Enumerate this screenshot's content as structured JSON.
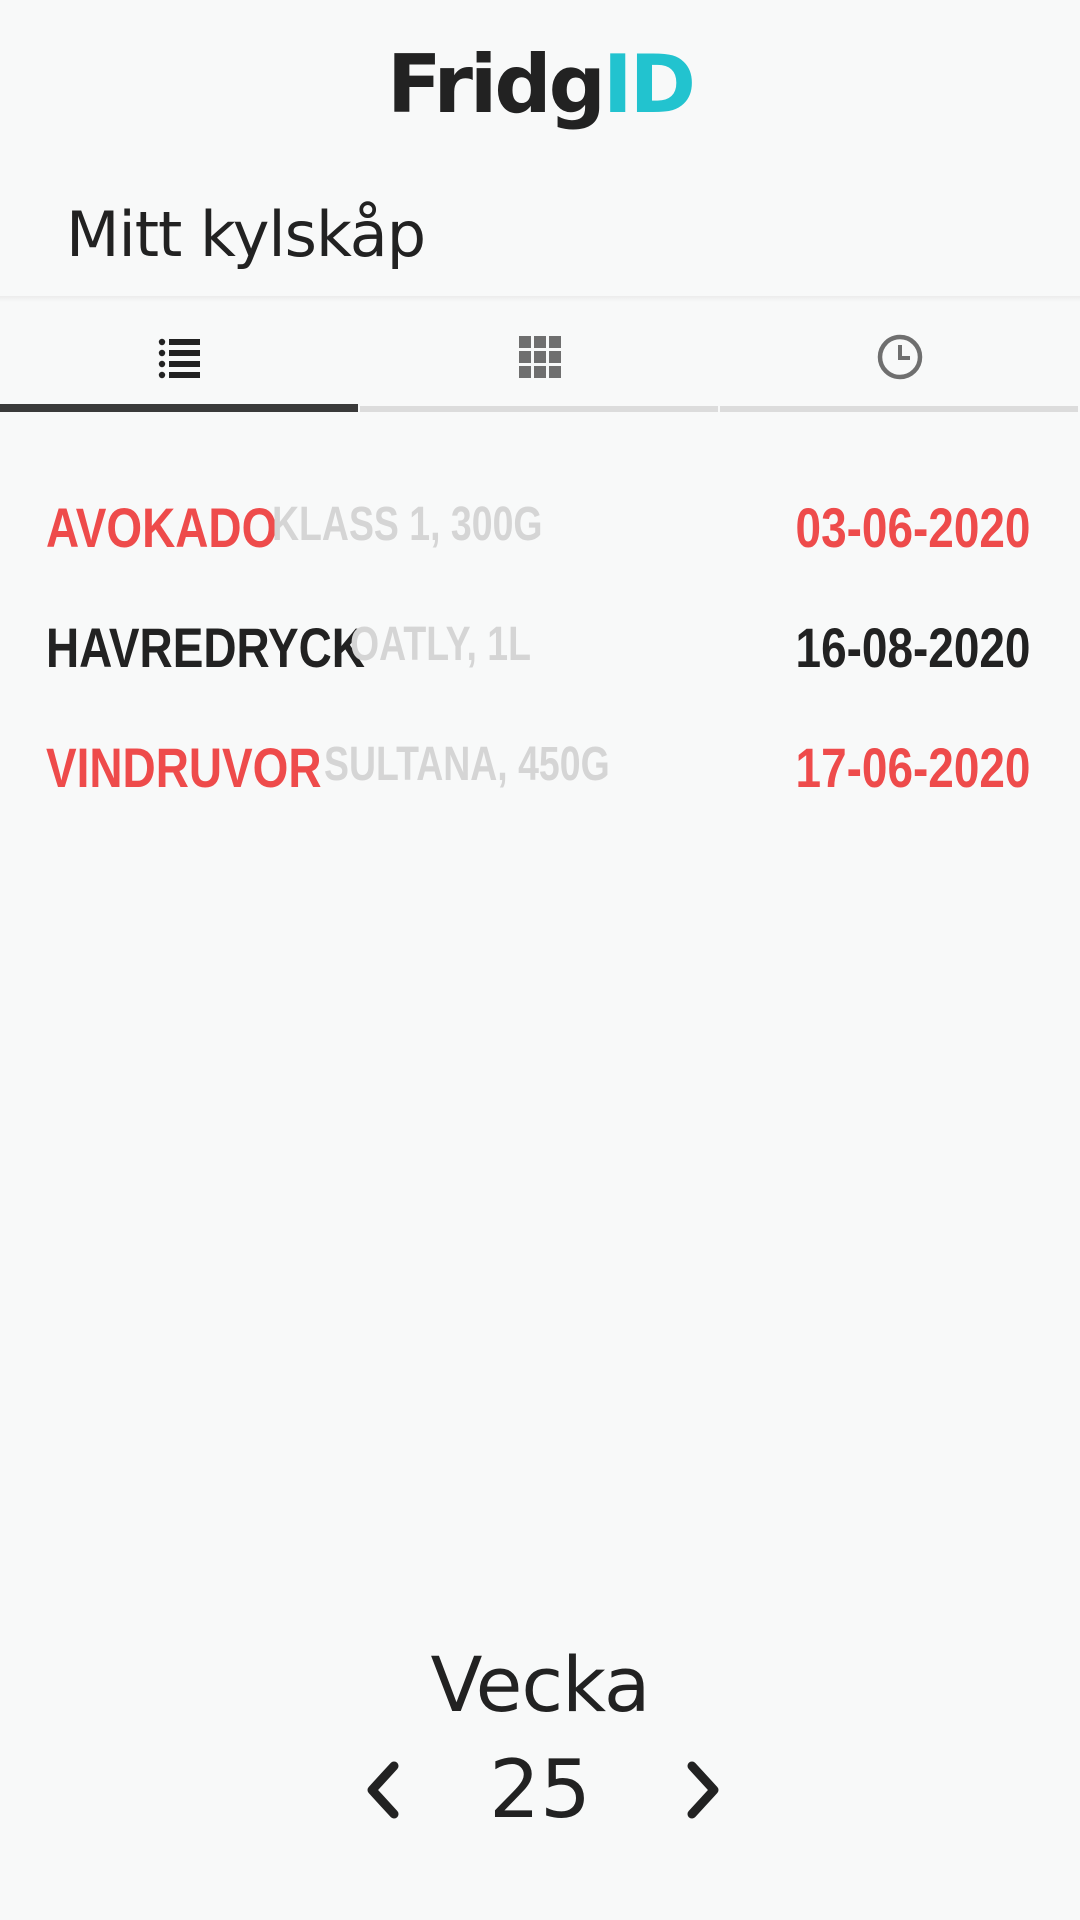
{
  "app": {
    "brand_part_a": "Fridg",
    "brand_part_b": "ID",
    "brand_colors": {
      "primary": "#222222",
      "accent": "#22c3cf"
    }
  },
  "page": {
    "title": "Mitt kylskåp"
  },
  "tabs": [
    {
      "icon": "list-icon",
      "active": true
    },
    {
      "icon": "grid-icon",
      "active": false
    },
    {
      "icon": "clock-icon",
      "active": false
    }
  ],
  "items": [
    {
      "name": "AVOKADO",
      "detail": "KLASS 1, 300G",
      "date": "03-06-2020",
      "status_color": "#ee4b4b"
    },
    {
      "name": "HAVREDRYCK",
      "detail": "OATLY, 1L",
      "date": "16-08-2020",
      "status_color": "#222222"
    },
    {
      "name": "VINDRUVOR",
      "detail": "SULTANA, 450G",
      "date": "17-06-2020",
      "status_color": "#ee4b4b"
    }
  ],
  "week": {
    "label": "Vecka",
    "number": "25",
    "prev_icon": "chevron-left-icon",
    "next_icon": "chevron-right-icon"
  }
}
